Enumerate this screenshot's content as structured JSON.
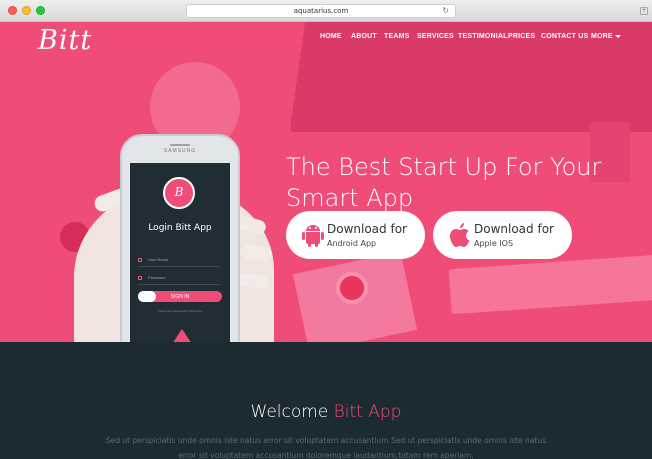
{
  "browser": {
    "url": "aquatarius.com"
  },
  "nav": {
    "logo": "Bitt",
    "items": [
      "HOME",
      "ABOUT",
      "TEAMS",
      "SERVICES",
      "TESTIMONIAL",
      "PRICES",
      "CONTACT US"
    ],
    "more": "MORE"
  },
  "hero": {
    "headline_line1": "The Best Start Up For Your",
    "headline_line2": "Smart App",
    "android": {
      "title": "Download for",
      "subtitle": "Android App",
      "icon": "android-icon"
    },
    "apple": {
      "title": "Download for",
      "subtitle": "Apple IOS",
      "icon": "apple-icon"
    }
  },
  "phone": {
    "brand": "SAMSUNG",
    "app_logo": "B",
    "login_title": "Login Bitt App",
    "user_placeholder": "User Name",
    "password_placeholder": "Password",
    "signin": "SIGN IN",
    "forgot": "Forgot the Password? Click Here"
  },
  "welcome": {
    "title_plain": "Welcome",
    "title_accent": "Bitt App",
    "text_line1": "Sed ut perspiciatis unde omnis iste natus error sit voluptatem accusantium Sed ut perspiciatis unde omnis iste natus",
    "text_line2": "error sit voluptatem accusantium doloremque laudantium,totam rem aperiam,"
  },
  "colors": {
    "accent": "#ef4d78",
    "dark": "#1c2a31"
  }
}
